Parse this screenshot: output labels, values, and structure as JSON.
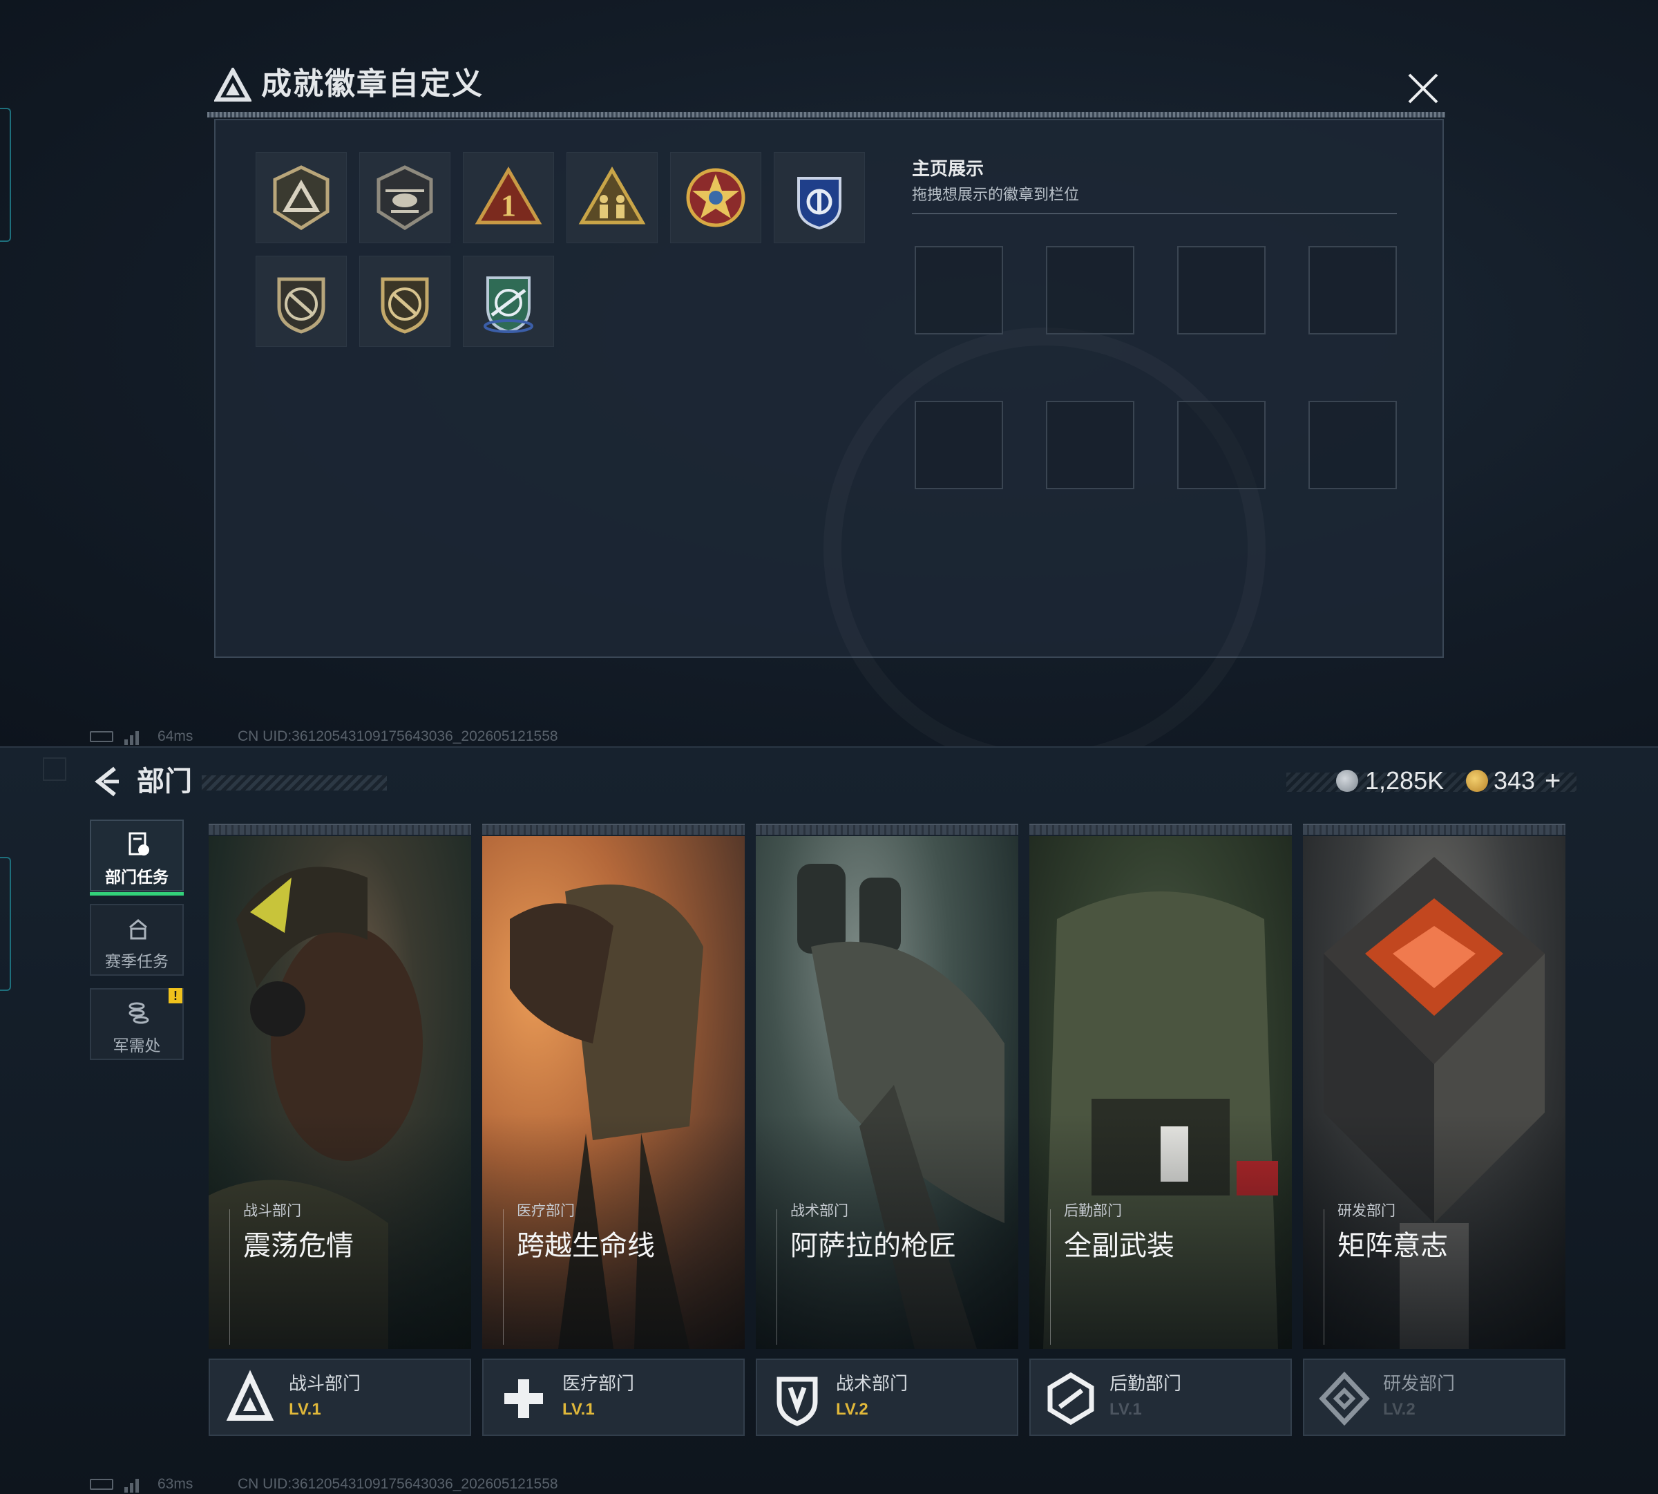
{
  "badge_modal": {
    "title": "成就徽章自定义",
    "showcase_title": "主页展示",
    "showcase_hint": "拖拽想展示的徽章到栏位",
    "badges": [
      {
        "name": "triangle-shield-badge-icon"
      },
      {
        "name": "helicopter-badge-icon"
      },
      {
        "name": "number-one-triangle-badge-icon"
      },
      {
        "name": "squad-triangle-badge-icon"
      },
      {
        "name": "star-medal-badge-icon"
      },
      {
        "name": "blue-crest-badge-icon"
      },
      {
        "name": "crossed-rifle-shield-badge-icon"
      },
      {
        "name": "crossed-rifle-shield-badge-2-icon"
      },
      {
        "name": "green-crosshair-crest-badge-icon"
      }
    ]
  },
  "status_bar": [
    {
      "latency": "64ms",
      "uid": "CN UID:36120543109175643036_202605121558"
    },
    {
      "latency": "63ms",
      "uid": "CN UID:36120543109175643036_202605121558"
    }
  ],
  "department": {
    "title": "部门",
    "currency": {
      "coins": "1,285K",
      "tokens": "343",
      "add": "+",
      "colors": {
        "coins": "#9aa3ad",
        "tokens": "#d9a63a"
      }
    },
    "side_tabs": [
      {
        "label": "部门任务",
        "icon": "mission-doc-icon",
        "active": true
      },
      {
        "label": "赛季任务",
        "icon": "season-chevron-icon",
        "active": false
      },
      {
        "label": "军需处",
        "icon": "coin-stack-icon",
        "active": false,
        "alert": "!"
      }
    ],
    "cards": [
      {
        "dept": "战斗部门",
        "mission": "震荡危情",
        "level": "LV.1",
        "icon": "combat-dept-icon",
        "locked": false
      },
      {
        "dept": "医疗部门",
        "mission": "跨越生命线",
        "level": "LV.1",
        "icon": "medical-dept-icon",
        "locked": false
      },
      {
        "dept": "战术部门",
        "mission": "阿萨拉的枪匠",
        "level": "LV.2",
        "icon": "tactical-dept-icon",
        "locked": false
      },
      {
        "dept": "后勤部门",
        "mission": "全副武装",
        "level": "LV.1",
        "icon": "logistics-dept-icon",
        "locked": false
      },
      {
        "dept": "研发部门",
        "mission": "矩阵意志",
        "level": "LV.2",
        "icon": "research-dept-icon",
        "locked": true
      }
    ],
    "accent_color": "#33d17a",
    "level_color": "#e0b83a"
  }
}
